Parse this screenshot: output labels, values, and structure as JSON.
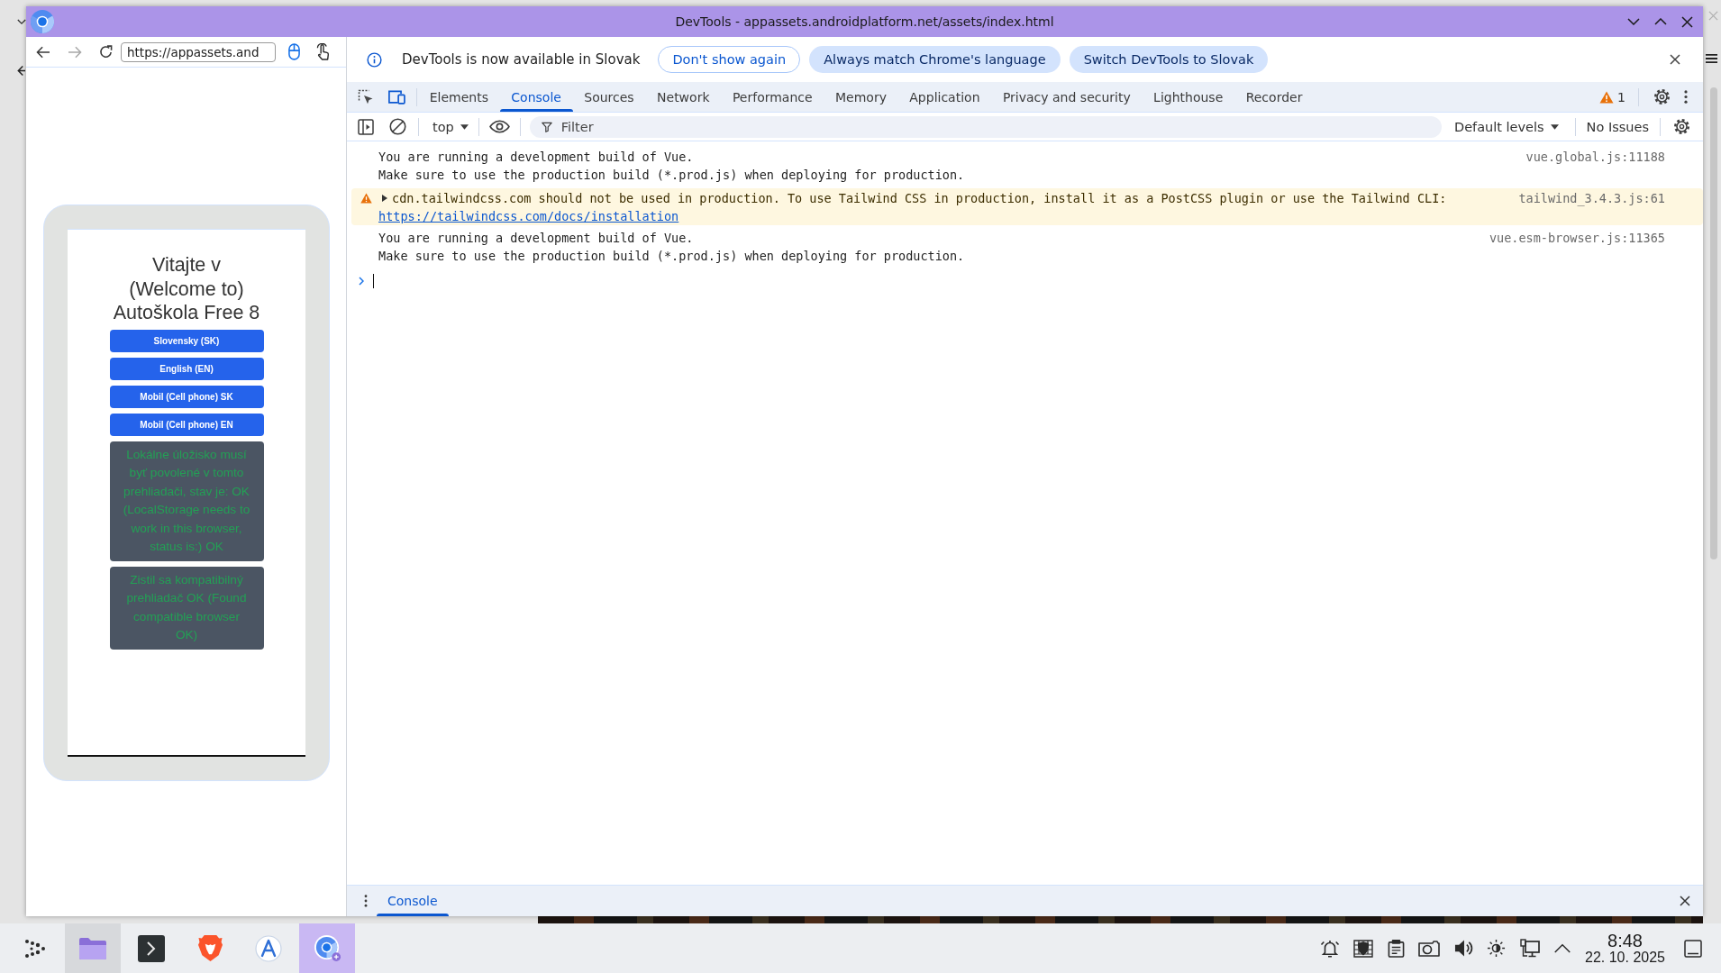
{
  "window": {
    "title": "DevTools - appassets.androidplatform.net/assets/index.html"
  },
  "browser_pane": {
    "nav_buttons": [
      {
        "kind": "back",
        "disabled": false
      },
      {
        "kind": "forward",
        "disabled": true
      },
      {
        "kind": "reload",
        "disabled": false
      }
    ],
    "url": "https://appassets.and",
    "input_modes": [
      {
        "kind": "mouse",
        "selected": true
      },
      {
        "kind": "touch",
        "selected": false
      }
    ],
    "page": {
      "heading": "Vitajte v (Welcome to) Autoškola Free 8",
      "buttons": [
        "Slovensky (SK)",
        "English (EN)",
        "Mobil (Cell phone) SK",
        "Mobil (Cell phone) EN"
      ],
      "notices": [
        "Lokálne úložisko musí byť povolené v tomto prehliadači, stav je: OK (LocalStorage needs to work in this browser, status is:) OK",
        "Zistil sa kompatibilný prehliadač OK (Found compatible browser OK)"
      ]
    }
  },
  "devtools": {
    "infobar": {
      "message": "DevTools is now available in Slovak",
      "buttons": [
        {
          "label": "Don't show again",
          "kind": "outlined"
        },
        {
          "label": "Always match Chrome's language",
          "kind": "tonal"
        },
        {
          "label": "Switch DevTools to Slovak",
          "kind": "tonal"
        }
      ]
    },
    "tool_toggles": [
      {
        "kind": "inspect",
        "on": false
      },
      {
        "kind": "device",
        "on": true
      }
    ],
    "tabs": [
      {
        "label": "Elements",
        "selected": false
      },
      {
        "label": "Console",
        "selected": true
      },
      {
        "label": "Sources",
        "selected": false
      },
      {
        "label": "Network",
        "selected": false
      },
      {
        "label": "Performance",
        "selected": false
      },
      {
        "label": "Memory",
        "selected": false
      },
      {
        "label": "Application",
        "selected": false
      },
      {
        "label": "Privacy and security",
        "selected": false
      },
      {
        "label": "Lighthouse",
        "selected": false
      },
      {
        "label": "Recorder",
        "selected": false
      }
    ],
    "issue_count": "1",
    "console_toolbar": {
      "context": "top",
      "filter": {
        "placeholder": "Filter"
      },
      "levels": "Default levels",
      "issues": "No Issues"
    },
    "messages": [
      {
        "kind": "log",
        "text": "You are running a development build of Vue.\nMake sure to use the production build (*.prod.js) when deploying for production.",
        "source": "vue.global.js:11188"
      },
      {
        "kind": "warning",
        "expanded": false,
        "text": "cdn.tailwindcss.com should not be used in production. To use Tailwind CSS in production, install it as a PostCSS plugin or use the Tailwind CLI:",
        "link": "https://tailwindcss.com/docs/installation",
        "source": "tailwind_3.4.3.js:61"
      },
      {
        "kind": "log",
        "text": "You are running a development build of Vue.\nMake sure to use the production build (*.prod.js) when deploying for production.",
        "source": "vue.esm-browser.js:11365"
      }
    ],
    "drawer": {
      "tabs": [
        {
          "label": "Console",
          "selected": true
        }
      ]
    }
  },
  "taskbar": {
    "apps": [
      {
        "kind": "launcher",
        "open": false,
        "selected": false
      },
      {
        "kind": "files",
        "open": true,
        "selected": false
      },
      {
        "kind": "terminal",
        "open": false,
        "selected": false
      },
      {
        "kind": "shield",
        "open": false,
        "selected": false
      },
      {
        "kind": "store",
        "open": false,
        "selected": false
      },
      {
        "kind": "browser",
        "open": true,
        "selected": true
      }
    ],
    "clock": {
      "time": "8:48",
      "date": "22. 10. 2025"
    }
  }
}
